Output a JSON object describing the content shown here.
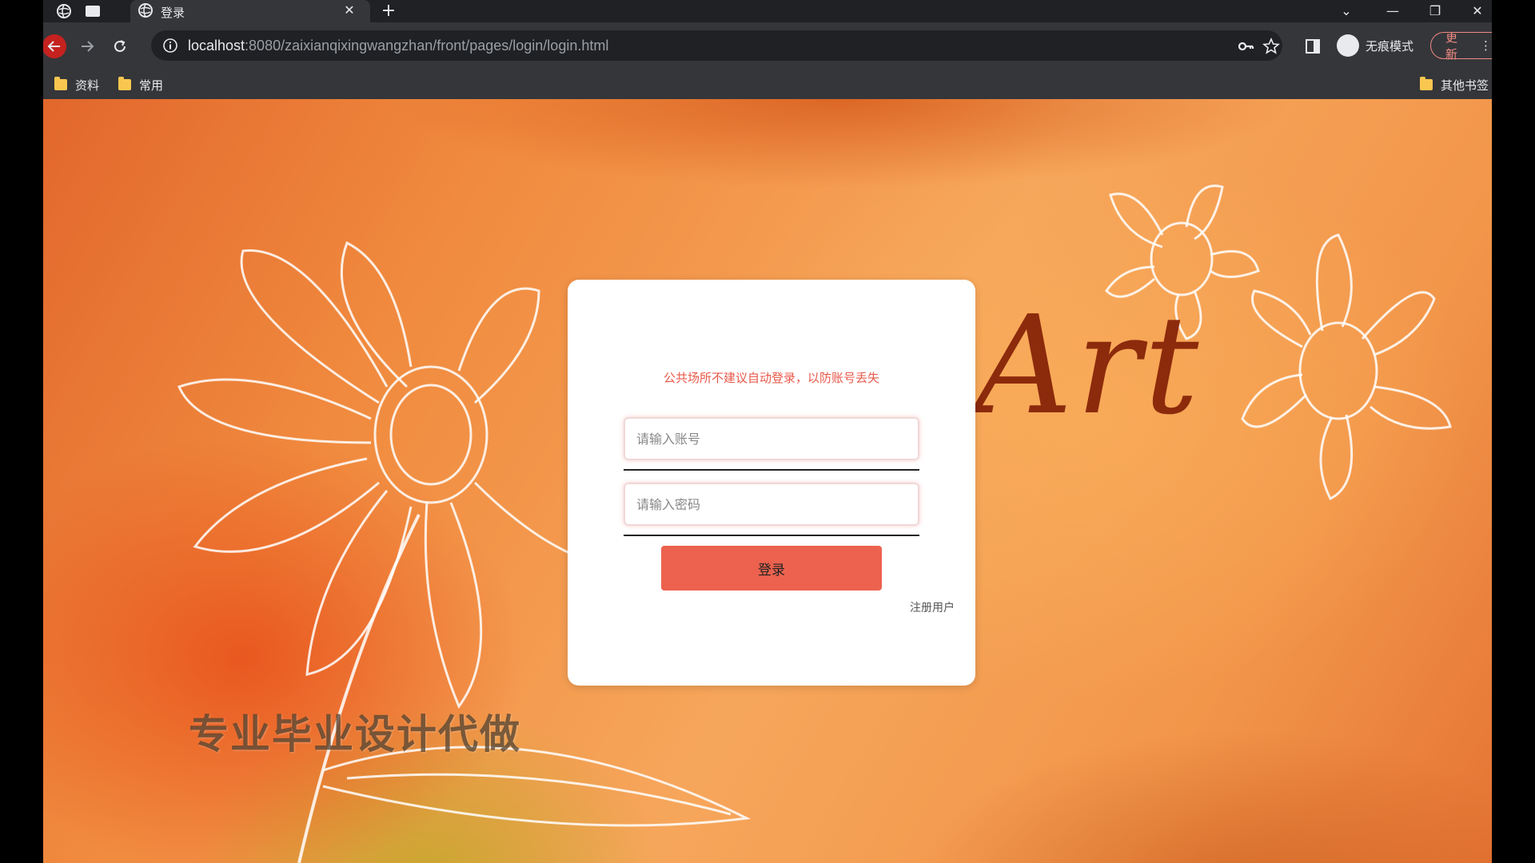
{
  "browser": {
    "tab_title": "登录",
    "url_host": "localhost",
    "url_rest": ":8080/zaixianqixingwangzhan/front/pages/login/login.html",
    "incognito_label": "无痕模式",
    "update_label": "更新",
    "bookmarks": [
      "资料",
      "常用"
    ],
    "other_bookmarks": "其他书签"
  },
  "page": {
    "art_text": "Art",
    "watermark": "专业毕业设计代做"
  },
  "login": {
    "notice": "公共场所不建议自动登录，以防账号丢失",
    "account_placeholder": "请输入账号",
    "password_placeholder": "请输入密码",
    "submit_label": "登录",
    "register_label": "注册用户"
  },
  "colors": {
    "accent": "#ec624e",
    "notice": "#e8594a",
    "art": "#8c2a0c"
  }
}
